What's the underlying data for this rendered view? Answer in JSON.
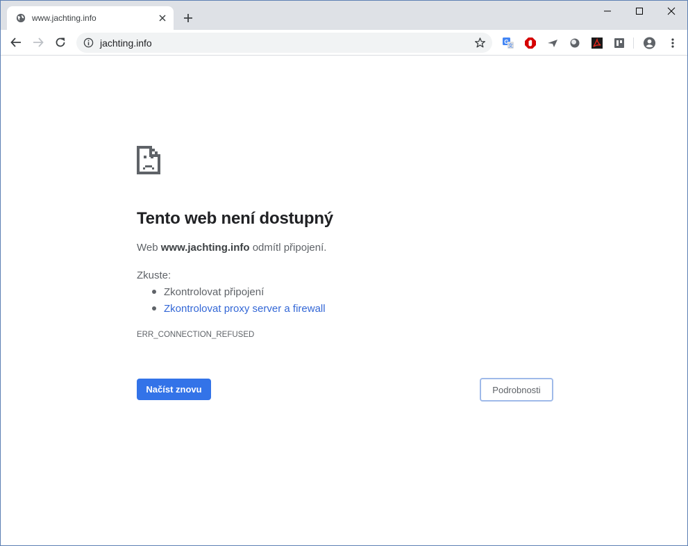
{
  "tab": {
    "title": "www.jachting.info",
    "favicon": "globe-icon"
  },
  "window_controls": [
    "minimize-icon",
    "maximize-icon",
    "close-icon"
  ],
  "address_bar": {
    "url": "jachting.info",
    "info_icon": "info-icon",
    "bookmark_icon": "star-icon"
  },
  "extensions": [
    "google-translate-icon",
    "adblock-icon",
    "send-icon",
    "circle-extension-icon",
    "adobe-acrobat-icon",
    "extension-icon"
  ],
  "error": {
    "title": "Tento web není dostupný",
    "desc_prefix": "Web ",
    "desc_host": "www.jachting.info",
    "desc_suffix": " odmítl připojení.",
    "try_label": "Zkuste:",
    "suggestions": [
      "Zkontrolovat připojení",
      "Zkontrolovat proxy server a firewall"
    ],
    "code": "ERR_CONNECTION_REFUSED",
    "reload_button": "Načíst znovu",
    "details_button": "Podrobnosti"
  },
  "colors": {
    "accent": "#3373e8",
    "link": "#3367d6",
    "tabstrip": "#dee1e6"
  }
}
